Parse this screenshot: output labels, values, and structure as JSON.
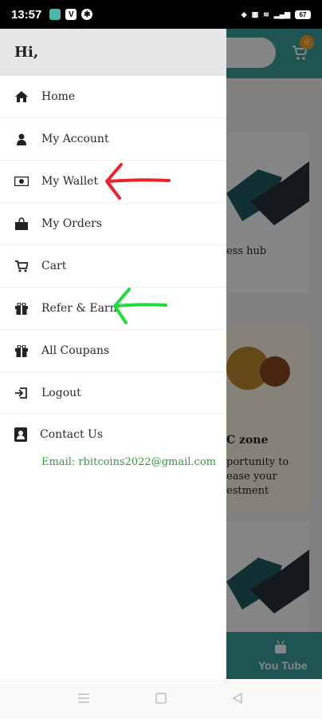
{
  "status_bar": {
    "time": "13:57",
    "battery": "67"
  },
  "drawer": {
    "greeting": "Hi,",
    "items": [
      {
        "label": "Home",
        "icon": "home-icon"
      },
      {
        "label": "My Account",
        "icon": "person-icon"
      },
      {
        "label": "My Wallet",
        "icon": "wallet-icon"
      },
      {
        "label": "My Orders",
        "icon": "bag-icon"
      },
      {
        "label": "Cart",
        "icon": "cart-icon"
      },
      {
        "label": "Refer & Earn",
        "icon": "gift-icon"
      },
      {
        "label": "All Coupans",
        "icon": "gift-icon"
      },
      {
        "label": "Logout",
        "icon": "logout-icon"
      }
    ],
    "contact": {
      "label": "Contact Us",
      "icon": "contact-card-icon",
      "email": "Email: rbitcoins2022@gmail.com"
    }
  },
  "background_app": {
    "cart_badge": "0",
    "card1_text": "ess hub",
    "card2_title": "C zone",
    "card2_text_1": "portunity to",
    "card2_text_2": "ease your",
    "card2_text_3": "estment",
    "bottom_nav_label": "You Tube"
  },
  "annotations": {
    "red_arrow_color": "#e8232b",
    "green_arrow_color": "#1fdc3c"
  },
  "colors": {
    "teal": "#3aa39d",
    "email_green": "#2e9e3a"
  }
}
